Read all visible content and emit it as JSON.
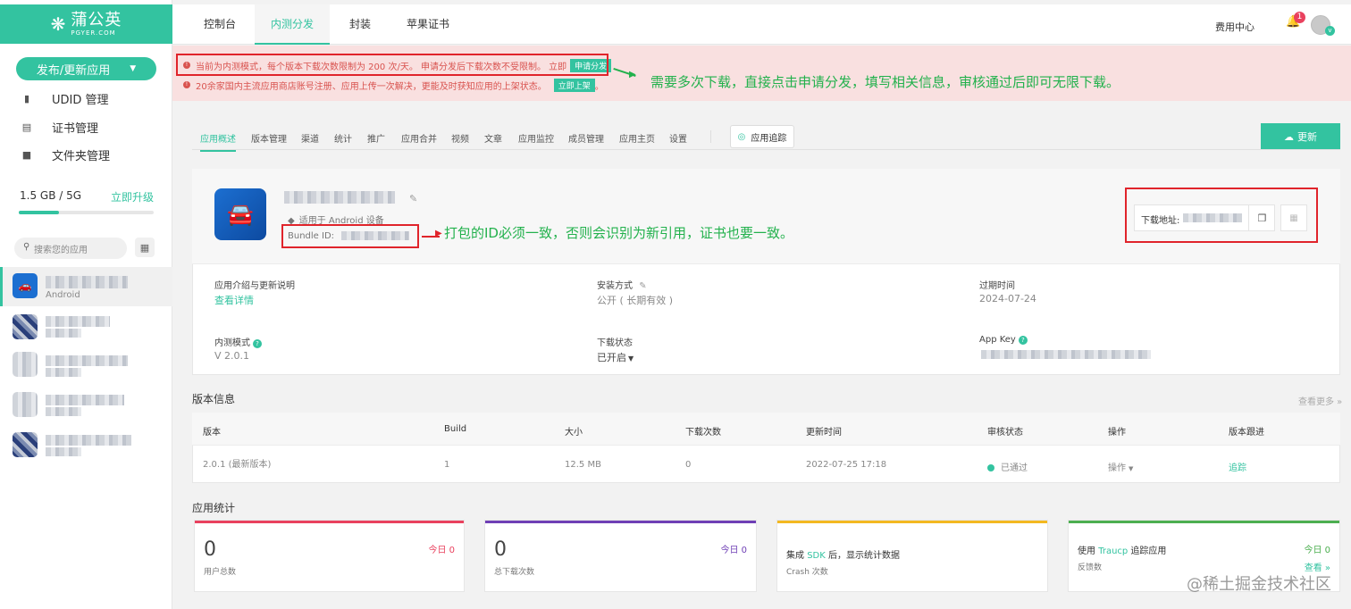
{
  "brand": {
    "name_cn": "蒲公英",
    "name_en": "PGYER.COM"
  },
  "sidebar": {
    "publish_label": "发布/更新应用",
    "items": [
      {
        "label": "UDID 管理",
        "icon": "phone-icon"
      },
      {
        "label": "证书管理",
        "icon": "certificate-icon"
      },
      {
        "label": "文件夹管理",
        "icon": "folder-icon"
      }
    ],
    "storage": {
      "used": "1.5 GB / 5G",
      "upgrade": "立即升级",
      "fraction": 0.3
    },
    "search_placeholder": "搜索您的应用",
    "active_app": {
      "platform": "Android"
    }
  },
  "topnav": {
    "tabs": [
      "控制台",
      "内测分发",
      "封装",
      "苹果证书"
    ],
    "active_tab": "内测分发",
    "fee_center": "费用中心",
    "notification_count": "1",
    "avatar_badge": "v"
  },
  "notices": [
    {
      "text": "当前为内测模式，每个版本下载次数限制为 200 次/天。 申请分发后下载次数不受限制。 立即",
      "button": "申请分发"
    },
    {
      "text": "20余家国内主流应用商店账号注册、应用上传一次解决，更能及时获知应用的上架状态。",
      "button": "立即上架",
      "suffix": "。"
    }
  ],
  "annotations": {
    "notice_note": "需要多次下载，直接点击申请分发，填写相关信息，审核通过后即可无限下载。",
    "bundle_note": "打包的ID必须一致，否则会识别为新引用，证书也要一致。"
  },
  "subtabs": [
    "应用概述",
    "版本管理",
    "渠道",
    "统计",
    "推广",
    "应用合并",
    "视频",
    "文章",
    "应用监控",
    "成员管理",
    "应用主页",
    "设置"
  ],
  "track_button": "应用追踪",
  "update_button": "更新",
  "app": {
    "platform_note": "适用于 Android 设备",
    "bundle_label": "Bundle ID:",
    "download_label": "下载地址:"
  },
  "info": {
    "intro_label": "应用介绍与更新说明",
    "intro_link": "查看详情",
    "install_label": "安装方式",
    "install_value": "公开 ( 长期有效 )",
    "expire_label": "过期时间",
    "expire_value": "2024-07-24",
    "mode_label": "内测模式",
    "mode_value": "V 2.0.1",
    "dl_status_label": "下载状态",
    "dl_status_value": "已开启",
    "appkey_label": "App Key"
  },
  "versions": {
    "title": "版本信息",
    "more": "查看更多 »",
    "headers": [
      "版本",
      "Build",
      "大小",
      "下载次数",
      "更新时间",
      "审核状态",
      "操作",
      "版本跟进"
    ],
    "row": {
      "version": "2.0.1 (最新版本)",
      "build": "1",
      "size": "12.5 MB",
      "downloads": "0",
      "updated": "2022-07-25 17:18",
      "status": "已通过",
      "action": "操作",
      "follow": "追踪"
    }
  },
  "stats": {
    "title": "应用统计",
    "cards": [
      {
        "value": "0",
        "label": "用户总数",
        "today": "今日 0",
        "color": "#e9415e"
      },
      {
        "value": "0",
        "label": "总下载次数",
        "today": "今日 0",
        "color": "#6f3fb5"
      },
      {
        "pre": "集成 ",
        "link": "SDK",
        "post": " 后，显示统计数据",
        "label": "Crash 次数",
        "color": "#f3b820"
      },
      {
        "pre": "使用 ",
        "link": "Traucp",
        "post": " 追踪应用",
        "label": "反馈数",
        "today": "今日 0",
        "more": "查看 »",
        "color": "#4caf50"
      }
    ]
  },
  "watermark": "@稀土掘金技术社区",
  "colors": {
    "accent": "#33c3a0",
    "notice": "#d9534f",
    "annotation_red": "#e0242b",
    "annotation_green": "#22b14c"
  }
}
